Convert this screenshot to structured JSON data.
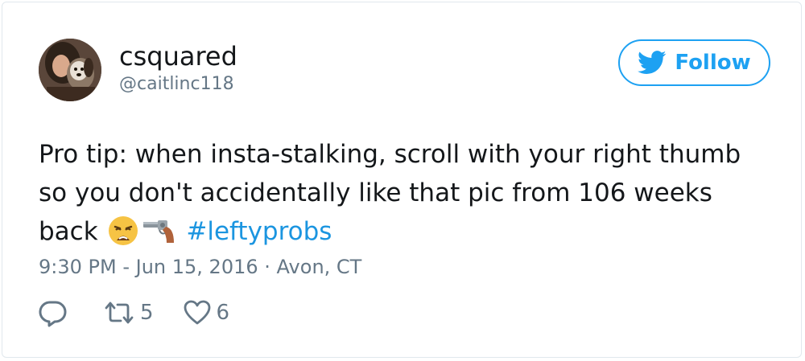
{
  "user": {
    "display_name": "csquared",
    "handle": "@caitlinc118"
  },
  "follow": {
    "label": "Follow",
    "icon": "twitter-bird-icon"
  },
  "tweet": {
    "text_before": "Pro tip: when insta-stalking, scroll with your right thumb so you don't accidentally like that pic from 106 weeks back",
    "emojis": [
      "weary-face-icon",
      "revolver-icon"
    ],
    "hashtag": "#leftyprobs",
    "timestamp": "9:30 PM - Jun 15, 2016",
    "separator": "·",
    "location": "Avon, CT"
  },
  "actions": {
    "reply": {
      "icon": "reply-icon"
    },
    "retweet": {
      "icon": "retweet-icon",
      "count": "5"
    },
    "like": {
      "icon": "heart-icon",
      "count": "6"
    }
  },
  "colors": {
    "accent": "#1da1f2",
    "hashtag": "#1b95e0",
    "secondary_text": "#657786",
    "border": "#e1e8ed"
  }
}
